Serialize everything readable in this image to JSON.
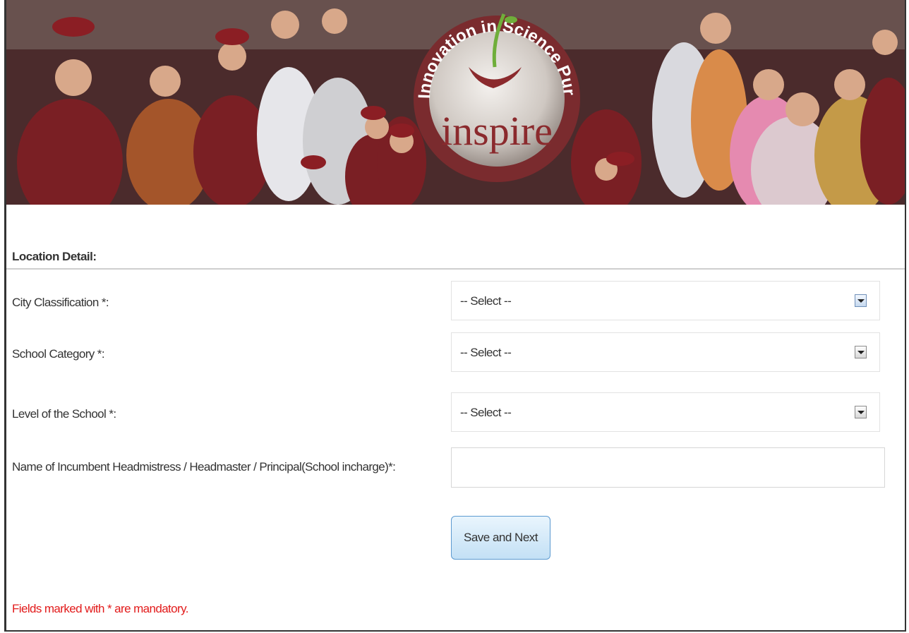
{
  "banner": {
    "logo_word": "inspire",
    "logo_ring_text": "Innovation in Science Pursuit for Inspired Research"
  },
  "section": {
    "title": "Location Detail:"
  },
  "fields": {
    "city_classification": {
      "label": "City Classification *:",
      "value": "-- Select --"
    },
    "school_category": {
      "label": "School Category *:",
      "value": "-- Select --"
    },
    "school_level": {
      "label": "Level of the School *:",
      "value": "-- Select --"
    },
    "principal_name": {
      "label": "Name of Incumbent Headmistress / Headmaster / Principal(School incharge)*:",
      "value": ""
    }
  },
  "actions": {
    "save_next": "Save and Next"
  },
  "note": "Fields marked with * are mandatory.",
  "colors": {
    "brand_maroon": "#8b2a2d",
    "note_red": "#e21b1b",
    "button_border": "#5d9ad0"
  }
}
